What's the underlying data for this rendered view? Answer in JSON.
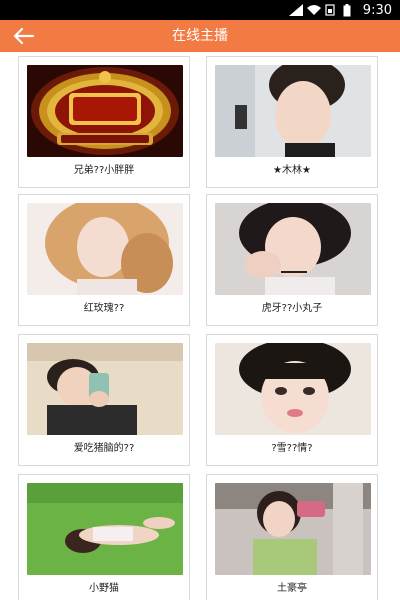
{
  "status_bar": {
    "time": "9:30",
    "icons": [
      "wifi-icon",
      "signal-icon",
      "sim-icon",
      "battery-icon"
    ]
  },
  "app_bar": {
    "title": "在线主播",
    "back_icon": "back-arrow-icon"
  },
  "hosts": [
    {
      "name": "兄弟??小胖胖",
      "image_desc": "brother-badge-logo"
    },
    {
      "name": "★木林★",
      "image_desc": "woman-portrait"
    },
    {
      "name": "红玫瑰??",
      "image_desc": "woman-curly-hair"
    },
    {
      "name": "虎牙??小丸子",
      "image_desc": "woman-chin-on-hand"
    },
    {
      "name": "爱吃猪脑的??",
      "image_desc": "woman-with-cup"
    },
    {
      "name": "?雪??情?",
      "image_desc": "woman-bangs-closeup"
    },
    {
      "name": "小野猫",
      "image_desc": "woman-on-grass"
    },
    {
      "name": "土豪亭",
      "image_desc": "woman-with-phone"
    }
  ],
  "colors": {
    "app_bar": "#f27b43",
    "card_border": "#d9d9d9"
  }
}
